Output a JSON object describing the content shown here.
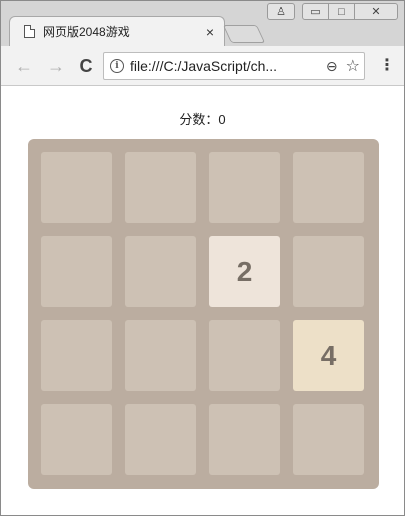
{
  "browser": {
    "tab_title": "网页版2048游戏",
    "tab_close": "×",
    "url": "file:///C:/JavaScript/ch...",
    "window_buttons": {
      "user": "♙",
      "minimize": "▭",
      "maximize": "□",
      "close": "✕"
    },
    "nav": {
      "back": "←",
      "forward": "→",
      "reload": "C"
    },
    "icons": {
      "info": "i",
      "zoom": "⊖",
      "star": "☆",
      "menu": "⋮"
    }
  },
  "game": {
    "score_text": "分数：0",
    "grid": [
      [
        "",
        "",
        "",
        ""
      ],
      [
        "",
        "",
        "2",
        ""
      ],
      [
        "",
        "",
        "",
        "4"
      ],
      [
        "",
        "",
        "",
        ""
      ]
    ],
    "colors": {
      "board": "#bbada0",
      "empty": "#cdc1b4",
      "tile_2": "#eee4da",
      "tile_4": "#ede0c8",
      "text": "#776e65"
    }
  }
}
